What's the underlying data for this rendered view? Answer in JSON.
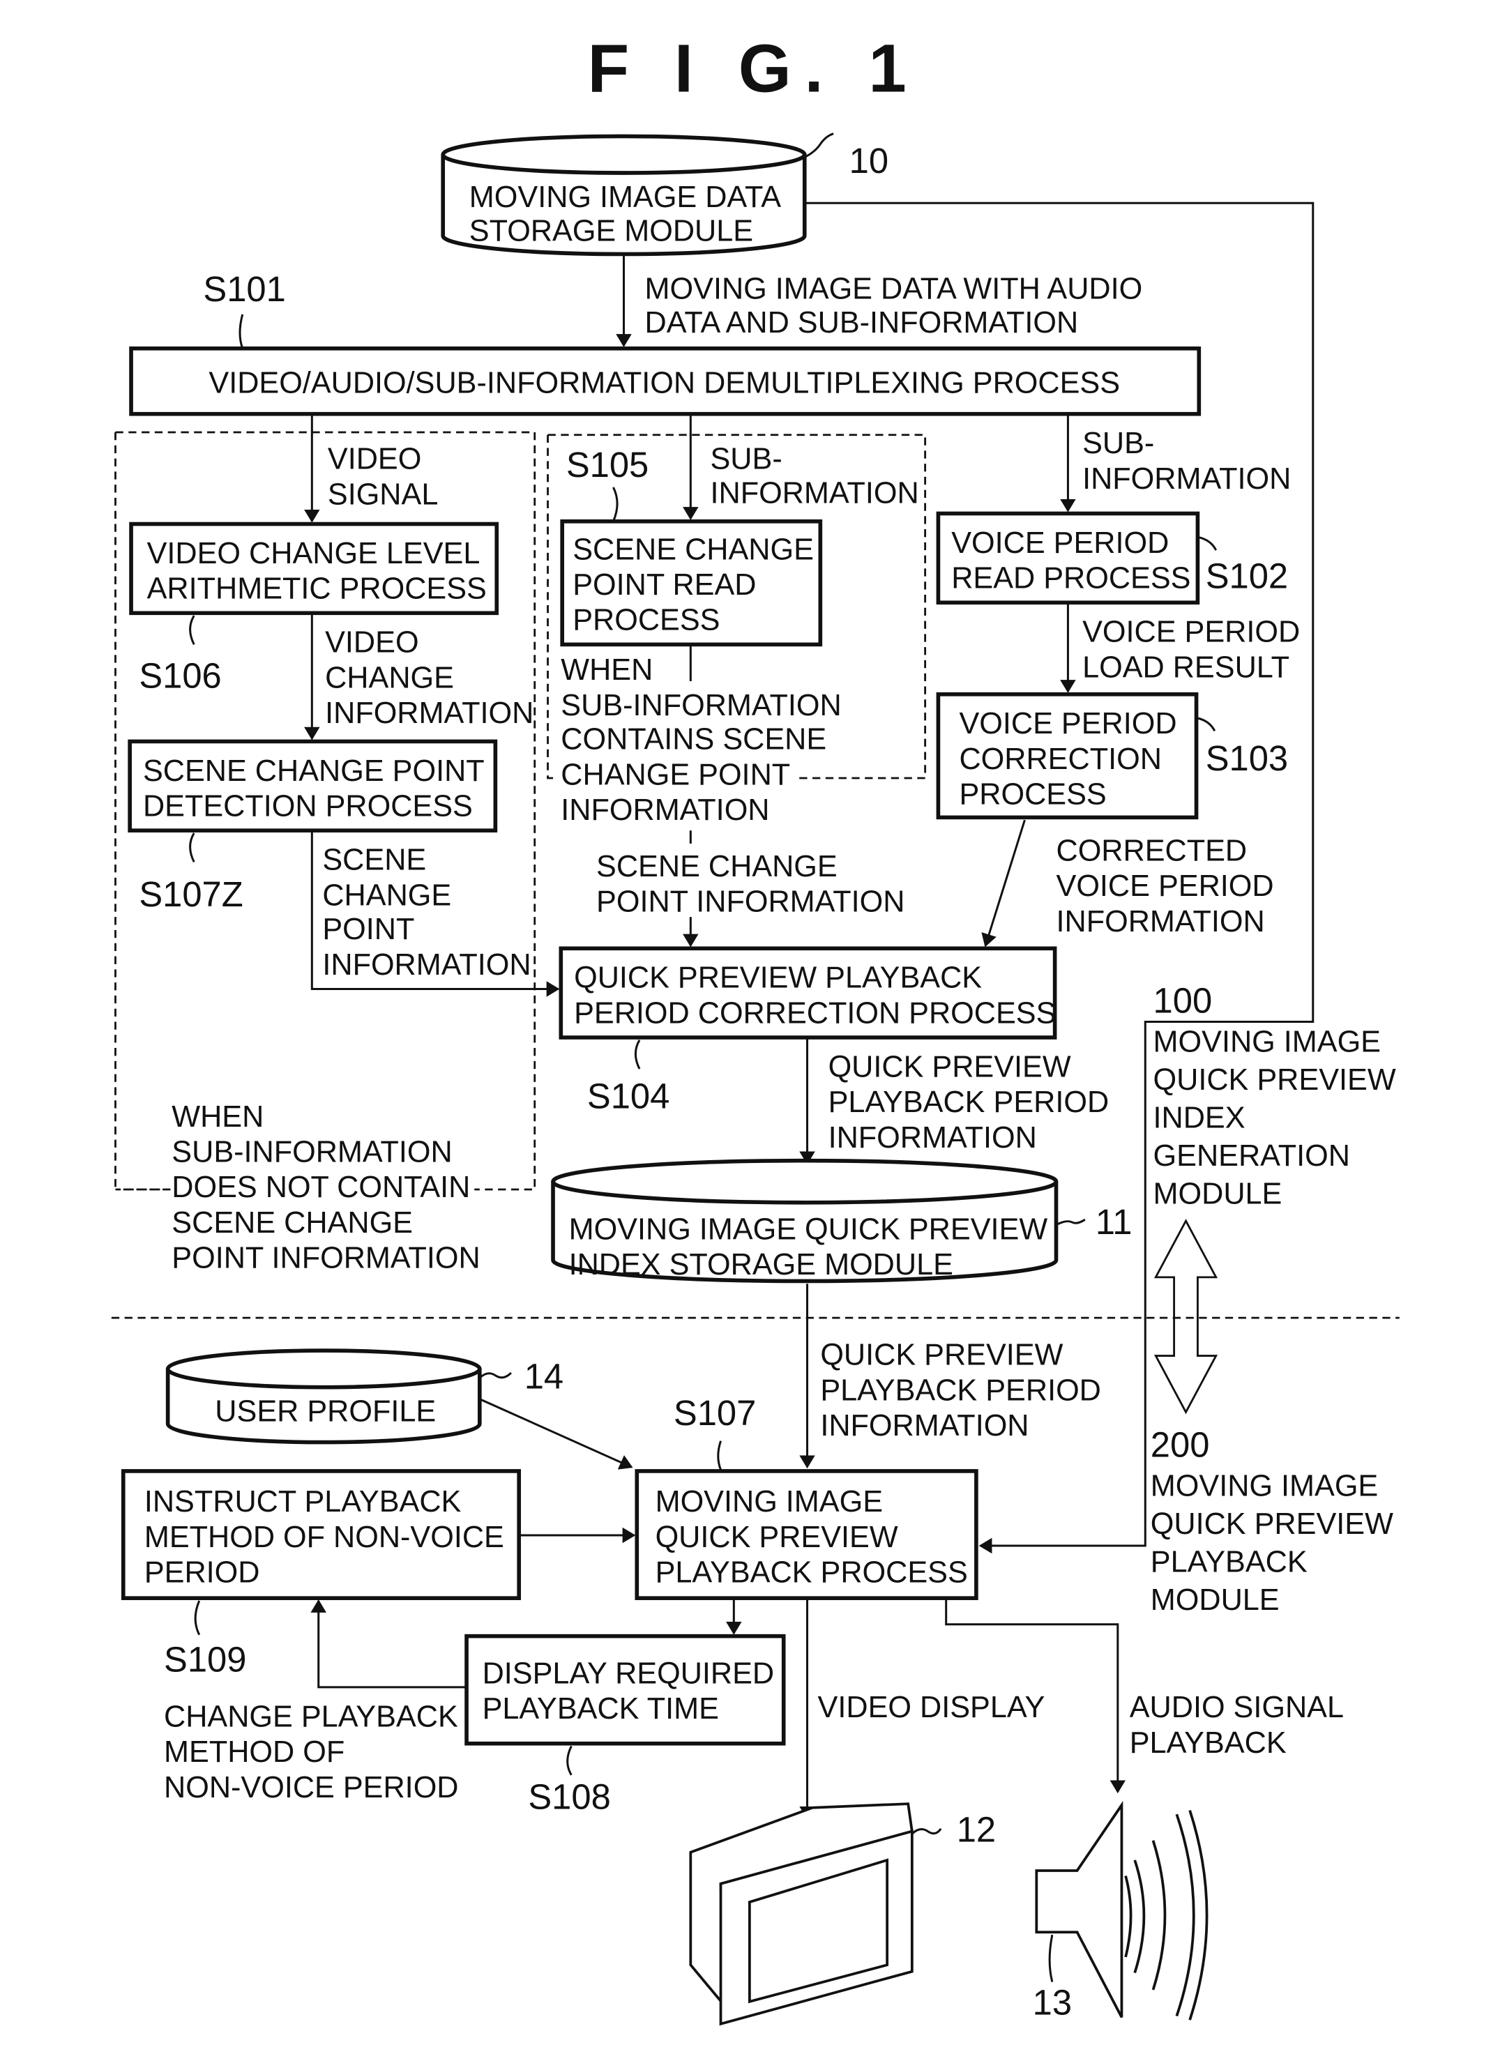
{
  "title": "F I G.  1",
  "modules": {
    "storage_10": {
      "ref": "10",
      "lines": [
        "MOVING IMAGE DATA",
        "STORAGE MODULE"
      ]
    },
    "index_storage_11": {
      "ref": "11",
      "lines": [
        "MOVING IMAGE QUICK PREVIEW",
        "INDEX STORAGE MODULE"
      ]
    },
    "user_profile_14": {
      "ref": "14",
      "lines": [
        "USER PROFILE"
      ]
    },
    "display_12": {
      "ref": "12"
    },
    "speaker_13": {
      "ref": "13"
    }
  },
  "steps": {
    "s101": {
      "ref": "S101",
      "lines": [
        "VIDEO/AUDIO/SUB-INFORMATION DEMULTIPLEXING PROCESS"
      ]
    },
    "s102": {
      "ref": "S102",
      "lines": [
        "VOICE PERIOD",
        "READ PROCESS"
      ]
    },
    "s103": {
      "ref": "S103",
      "lines": [
        "VOICE PERIOD",
        "CORRECTION",
        "PROCESS"
      ]
    },
    "s104": {
      "ref": "S104",
      "lines": [
        "QUICK PREVIEW PLAYBACK",
        "PERIOD CORRECTION PROCESS"
      ]
    },
    "s105": {
      "ref": "S105",
      "lines": [
        "SCENE CHANGE",
        "POINT READ",
        "PROCESS"
      ]
    },
    "s106": {
      "ref": "S106",
      "lines": [
        "VIDEO CHANGE LEVEL",
        "ARITHMETIC PROCESS"
      ]
    },
    "s107z": {
      "ref": "S107Z",
      "lines": [
        "SCENE CHANGE POINT",
        "DETECTION PROCESS"
      ]
    },
    "s107": {
      "ref": "S107",
      "lines": [
        "MOVING IMAGE",
        "QUICK PREVIEW",
        "PLAYBACK PROCESS"
      ]
    },
    "s108": {
      "ref": "S108",
      "lines": [
        "DISPLAY REQUIRED",
        "PLAYBACK TIME"
      ]
    },
    "s109": {
      "ref": "S109",
      "lines": [
        "INSTRUCT PLAYBACK",
        "METHOD OF NON-VOICE",
        "PERIOD"
      ]
    }
  },
  "labels": {
    "data_in": [
      "MOVING IMAGE DATA WITH AUDIO",
      "DATA AND SUB-INFORMATION"
    ],
    "video_signal": [
      "VIDEO",
      "SIGNAL"
    ],
    "sub_info_mid": [
      "SUB-",
      "INFORMATION"
    ],
    "sub_info_right": [
      "SUB-",
      "INFORMATION"
    ],
    "voice_load": [
      "VOICE PERIOD",
      "LOAD RESULT"
    ],
    "video_change_info": [
      "VIDEO",
      "CHANGE",
      "INFORMATION"
    ],
    "when_contains": [
      "WHEN",
      "SUB-INFORMATION",
      "CONTAINS SCENE",
      "CHANGE POINT",
      "INFORMATION"
    ],
    "scene_change_info_mid": [
      "SCENE CHANGE",
      "POINT INFORMATION"
    ],
    "scene_change_info_left": [
      "SCENE",
      "CHANGE",
      "POINT",
      "INFORMATION"
    ],
    "corrected_voice": [
      "CORRECTED",
      "VOICE PERIOD",
      "INFORMATION"
    ],
    "qp_period_info_1": [
      "QUICK PREVIEW",
      "PLAYBACK PERIOD",
      "INFORMATION"
    ],
    "when_not_contains": [
      "WHEN",
      "SUB-INFORMATION",
      "DOES NOT CONTAIN",
      "SCENE CHANGE",
      "POINT INFORMATION"
    ],
    "qp_period_info_2": [
      "QUICK PREVIEW",
      "PLAYBACK PERIOD",
      "INFORMATION"
    ],
    "change_method": [
      "CHANGE PLAYBACK",
      "METHOD OF",
      "NON-VOICE PERIOD"
    ],
    "video_display": [
      "VIDEO DISPLAY"
    ],
    "audio_playback": [
      "AUDIO SIGNAL",
      "PLAYBACK"
    ],
    "module_100": [
      "100",
      "MOVING IMAGE",
      "QUICK PREVIEW",
      "INDEX",
      "GENERATION",
      "MODULE"
    ],
    "module_200": [
      "200",
      "MOVING IMAGE",
      "QUICK PREVIEW",
      "PLAYBACK",
      "MODULE"
    ]
  }
}
